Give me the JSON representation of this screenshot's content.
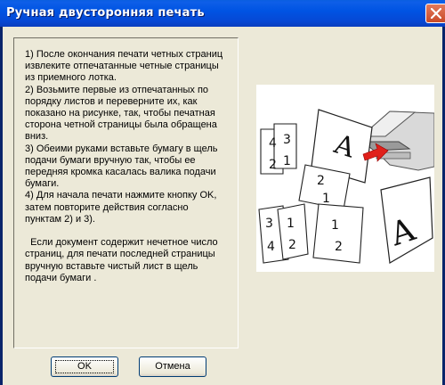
{
  "window": {
    "title": "Ручная двусторонняя печать"
  },
  "instructions": {
    "text": "1) После окончания печати четных страниц\nизвлеките отпечатанные четные страницы\nиз приемного лотка.\n2) Возьмите первые из отпечатанных по\nпорядку листов и переверните их, как\nпоказано на рисунке, так, чтобы печатная\nсторона четной страницы была обращена\nвниз.\n3) Обеими руками вставьте бумагу в щель\nподачи бумаги вручную так, чтобы ее\nпередняя кромка касалась валика подачи\nбумаги.\n4) Для начала печати нажмите кнопку OK,\nзатем повторите действия согласно\nпунктам 2) и 3).\n\n  Если документ содержит нечетное число\nстраниц, для печати последней страницы\nвручную вставьте чистый лист в щель\nподачи бумаги ."
  },
  "buttons": {
    "ok_label": "OK",
    "cancel_label": "Отмена"
  },
  "icons": {
    "close": "close-icon"
  },
  "colors": {
    "title_bar": "#0054e3",
    "close_button": "#d6583a",
    "dialog_face": "#ece9d8",
    "arrow_red": "#e0201a"
  }
}
